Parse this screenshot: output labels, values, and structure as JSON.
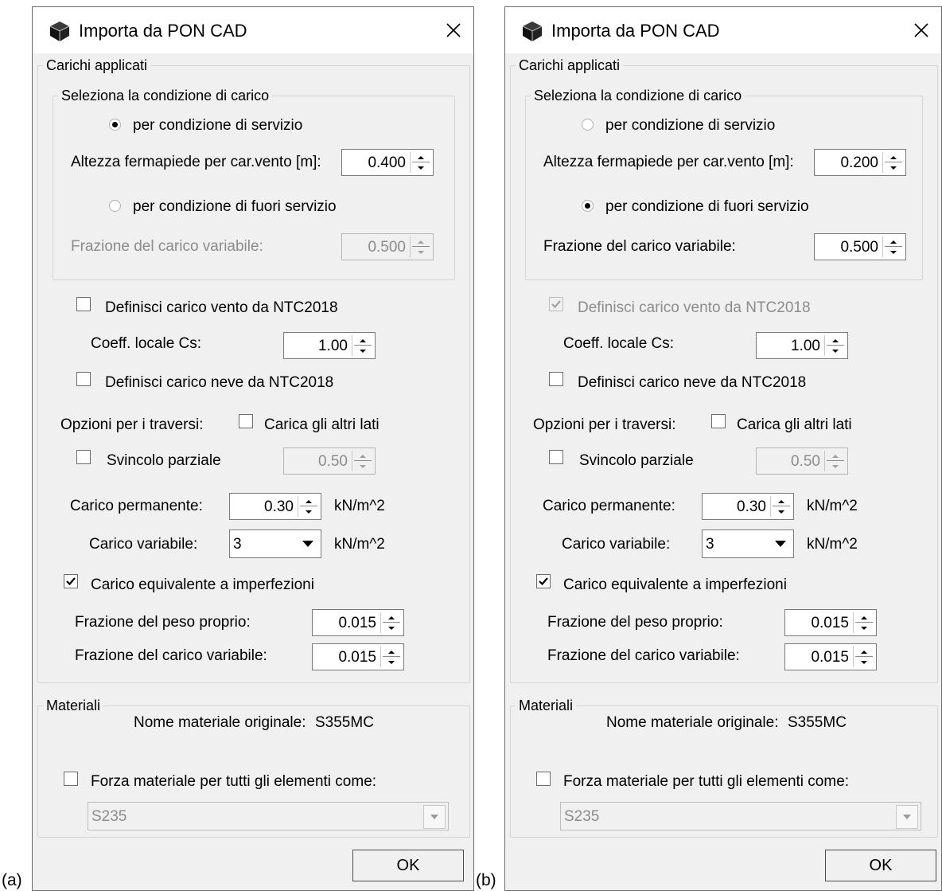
{
  "labels": {
    "a": "(a)",
    "b": "(b)"
  },
  "dialogs": [
    {
      "id": "a",
      "title": "Importa da PON CAD",
      "carichi": {
        "group_title": "Carichi applicati",
        "cond_group_title": "Seleziona la condizione di carico",
        "radio_servizio": {
          "label": "per condizione di servizio",
          "selected": true
        },
        "altezza": {
          "label": "Altezza fermapiede per car.vento [m]:",
          "value": "0.400",
          "enabled": true
        },
        "radio_fuori": {
          "label": "per condizione di fuori servizio",
          "selected": false
        },
        "frazione_cond": {
          "label": "Frazione del carico variabile:",
          "value": "0.500",
          "enabled": false
        },
        "vento": {
          "label": "Definisci carico vento da NTC2018",
          "checked": false,
          "enabled": true
        },
        "cs": {
          "label": "Coeff. locale Cs:",
          "value": "1.00",
          "enabled": true
        },
        "neve": {
          "label": "Definisci carico neve da NTC2018",
          "checked": false
        },
        "opzioni_label": "Opzioni per i traversi:",
        "altri_lati": {
          "label": "Carica gli altri lati",
          "checked": false
        },
        "svincolo": {
          "label": "Svincolo parziale",
          "checked": false,
          "value": "0.50"
        },
        "permanente": {
          "label": "Carico permanente:",
          "value": "0.30",
          "unit": "kN/m^2"
        },
        "variabile": {
          "label": "Carico variabile:",
          "value": "3",
          "unit": "kN/m^2"
        },
        "imperf": {
          "label": "Carico equivalente a imperfezioni",
          "checked": true
        },
        "peso_proprio": {
          "label": "Frazione del peso proprio:",
          "value": "0.015"
        },
        "frazione_var": {
          "label": "Frazione del carico variabile:",
          "value": "0.015"
        }
      },
      "materiali": {
        "group_title": "Materiali",
        "nome_label": "Nome materiale originale:",
        "nome_value": "S355MC",
        "forza": {
          "label": "Forza materiale per tutti gli elementi come:",
          "checked": false
        },
        "select_value": "S235"
      },
      "ok_label": "OK"
    },
    {
      "id": "b",
      "title": "Importa da PON CAD",
      "carichi": {
        "group_title": "Carichi applicati",
        "cond_group_title": "Seleziona la condizione di carico",
        "radio_servizio": {
          "label": "per condizione di servizio",
          "selected": false
        },
        "altezza": {
          "label": "Altezza fermapiede per car.vento [m]:",
          "value": "0.200",
          "enabled": true
        },
        "radio_fuori": {
          "label": "per condizione di fuori servizio",
          "selected": true
        },
        "frazione_cond": {
          "label": "Frazione del carico variabile:",
          "value": "0.500",
          "enabled": true
        },
        "vento": {
          "label": "Definisci carico vento da NTC2018",
          "checked": true,
          "enabled": false
        },
        "cs": {
          "label": "Coeff. locale Cs:",
          "value": "1.00",
          "enabled": true
        },
        "neve": {
          "label": "Definisci carico neve da NTC2018",
          "checked": false
        },
        "opzioni_label": "Opzioni per i traversi:",
        "altri_lati": {
          "label": "Carica gli altri lati",
          "checked": false
        },
        "svincolo": {
          "label": "Svincolo parziale",
          "checked": false,
          "value": "0.50"
        },
        "permanente": {
          "label": "Carico permanente:",
          "value": "0.30",
          "unit": "kN/m^2"
        },
        "variabile": {
          "label": "Carico variabile:",
          "value": "3",
          "unit": "kN/m^2"
        },
        "imperf": {
          "label": "Carico equivalente a imperfezioni",
          "checked": true
        },
        "peso_proprio": {
          "label": "Frazione del peso proprio:",
          "value": "0.015"
        },
        "frazione_var": {
          "label": "Frazione del carico variabile:",
          "value": "0.015"
        }
      },
      "materiali": {
        "group_title": "Materiali",
        "nome_label": "Nome materiale originale:",
        "nome_value": "S355MC",
        "forza": {
          "label": "Forza materiale per tutti gli elementi come:",
          "checked": false
        },
        "select_value": "S235"
      },
      "ok_label": "OK"
    }
  ]
}
